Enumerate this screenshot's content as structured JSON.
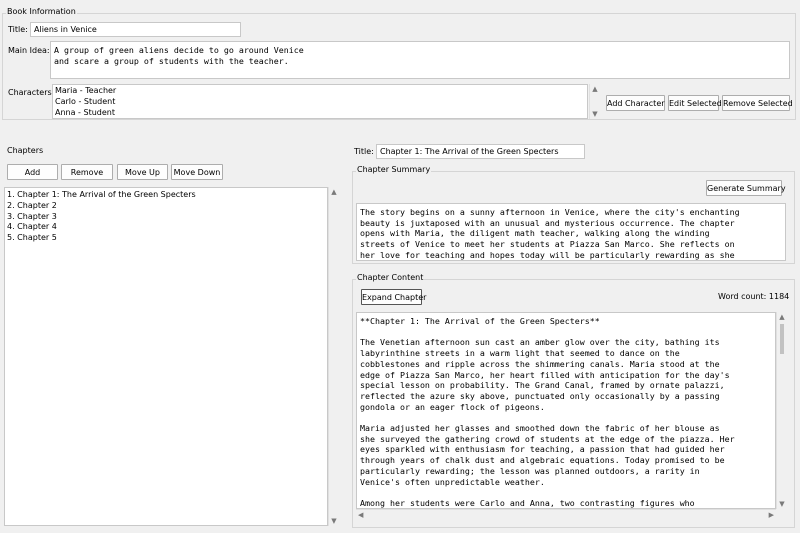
{
  "book_info": {
    "group_title": "Book Information",
    "title_label": "Title:",
    "title_value": "Aliens in Venice",
    "main_idea_label": "Main Idea:",
    "main_idea_text": "A group of green aliens decide to go around Venice\nand scare a group of students with the teacher.",
    "characters_label": "Characters:",
    "characters": [
      "Maria - Teacher",
      "Carlo - Student",
      "Anna - Student"
    ],
    "add_character": "Add Character",
    "edit_selected": "Edit Selected",
    "remove_selected": "Remove Selected"
  },
  "chapters": {
    "group_title": "Chapters",
    "add": "Add",
    "remove": "Remove",
    "move_up": "Move Up",
    "move_down": "Move Down",
    "items": [
      "1. Chapter 1: The Arrival of the Green Specters",
      "2. Chapter 2",
      "3. Chapter 3",
      "4. Chapter 4",
      "5. Chapter 5"
    ]
  },
  "chapter_editor": {
    "title_label": "Title:",
    "title_value": "Chapter 1: The Arrival of the Green Specters",
    "summary_group": "Chapter Summary",
    "generate_summary": "Generate Summary",
    "summary_text": "The story begins on a sunny afternoon in Venice, where the city's enchanting\nbeauty is juxtaposed with an unusual and mysterious occurrence. The chapter\nopens with Maria, the diligent math teacher, walking along the winding\nstreets of Venice to meet her students at Piazza San Marco. She reflects on\nher love for teaching and hopes today will be particularly rewarding as she",
    "content_group": "Chapter Content",
    "expand_chapter": "Expand Chapter",
    "word_count": "Word count: 1184",
    "content_text": "**Chapter 1: The Arrival of the Green Specters**\n\nThe Venetian afternoon sun cast an amber glow over the city, bathing its\nlabyrinthine streets in a warm light that seemed to dance on the\ncobblestones and ripple across the shimmering canals. Maria stood at the\nedge of Piazza San Marco, her heart filled with anticipation for the day's\nspecial lesson on probability. The Grand Canal, framed by ornate palazzi,\nreflected the azure sky above, punctuated only occasionally by a passing\ngondola or an eager flock of pigeons.\n\nMaria adjusted her glasses and smoothed down the fabric of her blouse as\nshe surveyed the gathering crowd of students at the edge of the piazza. Her\neyes sparkled with enthusiasm for teaching, a passion that had guided her\nthrough years of chalk dust and algebraic equations. Today promised to be\nparticularly rewarding; the lesson was planned outdoors, a rarity in\nVenice's often unpredictable weather.\n\nAmong her students were Carlo and Anna, two contrasting figures who"
  },
  "icons": {
    "scroll_up": "▲",
    "scroll_down": "▼",
    "scroll_left": "◀",
    "scroll_right": "▶"
  }
}
